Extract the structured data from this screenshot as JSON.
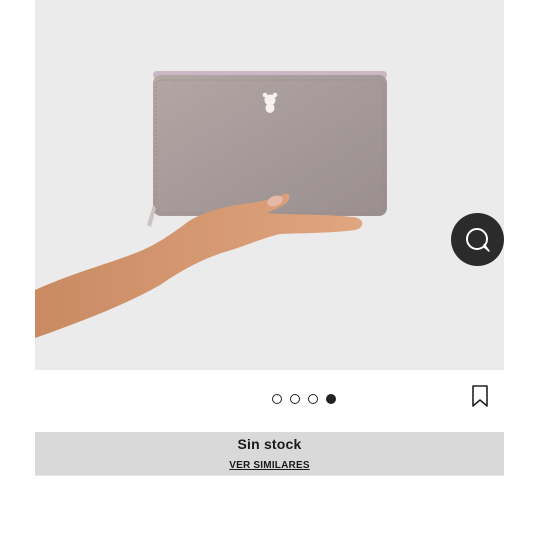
{
  "product": {
    "image_alt": "wallet held in hand",
    "carousel": {
      "total": 4,
      "active": 4
    },
    "stock_status": "Sin stock",
    "similar_link": "VER SIMILARES"
  },
  "icons": {
    "chat": "chat-bubble-icon",
    "save": "bookmark-icon",
    "brand_mark": "teddy-bear-logo"
  },
  "colors": {
    "photo_bg": "#ebebeb",
    "band_bg": "#d9d9d9",
    "chat_bg": "#2b2b2b",
    "wallet": "#a99c98"
  }
}
